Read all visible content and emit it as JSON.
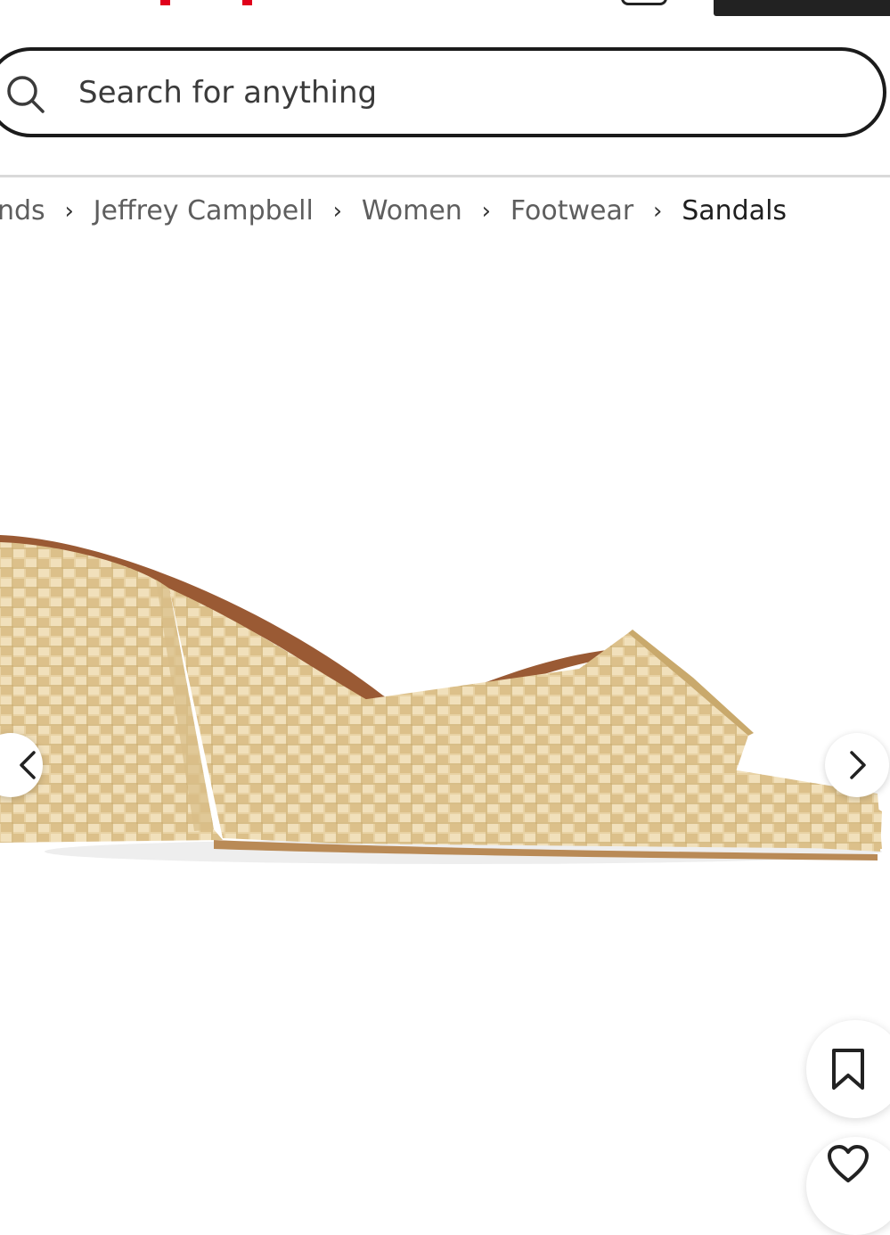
{
  "search": {
    "placeholder": "Search for anything"
  },
  "breadcrumb": [
    {
      "label": "nds"
    },
    {
      "label": "Jeffrey Campbell"
    },
    {
      "label": "Women"
    },
    {
      "label": "Footwear"
    },
    {
      "label": "Sandals",
      "current": true
    }
  ],
  "breadcrumb_separator": "›",
  "icons": {
    "search": "search-icon",
    "chevron_left": "chevron-left-icon",
    "chevron_right": "chevron-right-icon",
    "bookmark": "bookmark-icon",
    "heart": "heart-icon",
    "cart": "cart-icon"
  },
  "colors": {
    "brand_red": "#e0001b",
    "text_dark": "#1f1f1f",
    "text_muted": "#5e5e5e",
    "search_border": "#1b1b1b"
  }
}
